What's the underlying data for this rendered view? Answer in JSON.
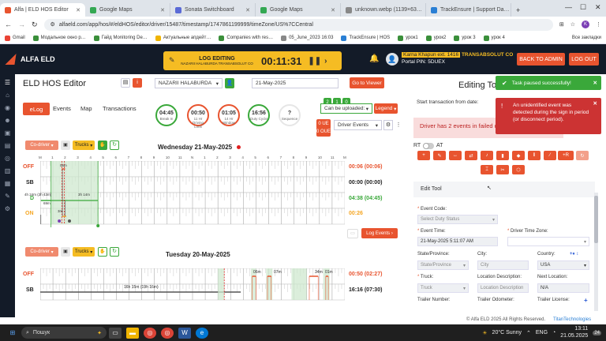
{
  "browser": {
    "tabs": [
      {
        "label": "Alfa | ELD HOS Editor",
        "color": "#e8542f",
        "active": true
      },
      {
        "label": "Google Maps",
        "color": "#34a853"
      },
      {
        "label": "Sonata Switchboard",
        "color": "#5b6bd6"
      },
      {
        "label": "Google Maps",
        "color": "#34a853"
      },
      {
        "label": "unknown.webp (1139×63…",
        "color": "#888"
      },
      {
        "label": "TrackEnsure | Support Da…",
        "color": "#2a7fd4"
      }
    ],
    "url": "alfaeld.com/app/hos/#/eldHOS/editor/driver/15487/timestamp/1747861199999/timeZone/US%7CCentral",
    "bookmarks": [
      {
        "label": "Gmail",
        "color": "#ea4335"
      },
      {
        "label": "Модальное окно р…",
        "color": "#3a8f3a"
      },
      {
        "label": "Гайд Monitoring De…",
        "color": "#3a8f3a"
      },
      {
        "label": "Актуальные апдейт…",
        "color": "#f0b400"
      },
      {
        "label": "Companies with res…",
        "color": "#3a8f3a"
      },
      {
        "label": "05_June_2023 16:03",
        "color": "#888"
      },
      {
        "label": "TrackEnsure | HOS",
        "color": "#2a7fd4"
      },
      {
        "label": "урок1",
        "color": "#3a8f3a"
      },
      {
        "label": "урок2",
        "color": "#3a8f3a"
      },
      {
        "label": "урок 3",
        "color": "#3a8f3a"
      },
      {
        "label": "урок 4",
        "color": "#3a8f3a"
      }
    ],
    "all_bookmarks": "Все закладки"
  },
  "app": {
    "logo": "ALFA ELD",
    "log_editing_title": "LOG EDITING",
    "log_editing_sub": "NAZARII HALABURDA TRANSABSOLUT CO",
    "timer": "00:11:31",
    "carrier_name": "Karna Khapun ext. 1416",
    "carrier_company": "TRANSABSOLUT CO",
    "portal_pin": "Portal PIN: 5DUEX",
    "back_to_admin": "BACK TO ADMIN",
    "logout": "LOG OUT"
  },
  "editor": {
    "title": "ELD HOS Editor",
    "driver": "NAZARII HALABURDA",
    "date": "21-May-2025",
    "go_to_viewer": "Go to Viewer",
    "tabs": [
      "eLog",
      "Events",
      "Map",
      "Transactions"
    ],
    "clocks": [
      {
        "value": "04:45",
        "label": "Break In"
      },
      {
        "value": "00:50",
        "label": "11 Hr Driving Limit"
      },
      {
        "value": "01:05",
        "label": "14 Hr Window"
      },
      {
        "value": "16:56",
        "label": "Duty Cycle"
      },
      {
        "value": "?",
        "label": "Sequence"
      }
    ],
    "can_be_uploaded": "Can be uploaded:",
    "legend": "Legend",
    "ue": "0 UE",
    "oue": "0 OUE",
    "driver_events": "Driver Events",
    "badges": [
      "2",
      "1",
      "0"
    ]
  },
  "day1": {
    "title": "Wednesday 21-May-2025",
    "codriver": "Co-driver",
    "trucks": "Trucks",
    "status_labels": [
      "OFF",
      "SB",
      "D",
      "ON"
    ],
    "totals": [
      "00:06 (00:06)",
      "00:00 (00:00)",
      "04:38 (04:45)",
      "00:26"
    ],
    "hours": [
      "M",
      "1",
      "2",
      "3",
      "4",
      "5",
      "6",
      "7",
      "8",
      "9",
      "10",
      "11",
      "N",
      "1",
      "2",
      "3",
      "4",
      "5",
      "6",
      "7",
      "8",
      "9",
      "10",
      "11",
      "M"
    ],
    "annotations": [
      "4h 24m (2h 43m)",
      "3h 14m",
      "69m",
      "3m",
      "06m"
    ],
    "log_events": "Log Events"
  },
  "day2": {
    "title": "Tuesday 20-May-2025",
    "codriver": "Co-driver",
    "trucks": "Trucks",
    "status_labels": [
      "OFF",
      "SB"
    ],
    "totals": [
      "00:50 (02:27)",
      "16:16 (07:30)"
    ],
    "annotations": [
      "16h 15m (19h 16m)",
      "06m",
      "07m",
      "34m",
      "01m"
    ]
  },
  "right": {
    "editing_title": "Editing To",
    "start_transaction": "Start transaction from date:",
    "driver_alert": "Driver has 2 events in failed q",
    "rt": "RT",
    "at": "AT",
    "edit_tool": "Edit Tool",
    "event_code_label": "Event Code:",
    "event_code_placeholder": "Select Duty Status",
    "event_time_label": "Event Time:",
    "event_time_value": "21-May-2025 5:11:07 AM",
    "tz_label": "Driver Time Zone:",
    "state_label": "State/Province:",
    "state_placeholder": "State/Province",
    "city_label": "City:",
    "city_placeholder": "City",
    "country_label": "Country:",
    "country_value": "USA",
    "truck_label": "Truck:",
    "truck_placeholder": "Truck",
    "location_desc_label": "Location Description:",
    "location_desc_placeholder": "Location Description",
    "next_location_label": "Next Location:",
    "next_location_value": "N/A",
    "trailer_number_label": "Trailer Number:",
    "trailer_odometer_label": "Trailer Odometer:",
    "trailer_license_label": "Trailer License:"
  },
  "toasts": {
    "success": "Task paused successfully!",
    "error": "An unidentified event was detected during the sign in period (or disconnect period)."
  },
  "footer": {
    "copyright": "© Alfa ELD  2025 All Rights Reserved.",
    "partner": "TitanTechnologies"
  },
  "taskbar": {
    "search": "Пошук",
    "weather": "20°C  Sunny",
    "lang": "ENG",
    "time": "13:11",
    "date": "21.05.2025"
  },
  "colors": {
    "accent": "#e8542f",
    "dark": "#131b28",
    "yellow": "#f5bc23",
    "green": "#3aa83a"
  }
}
